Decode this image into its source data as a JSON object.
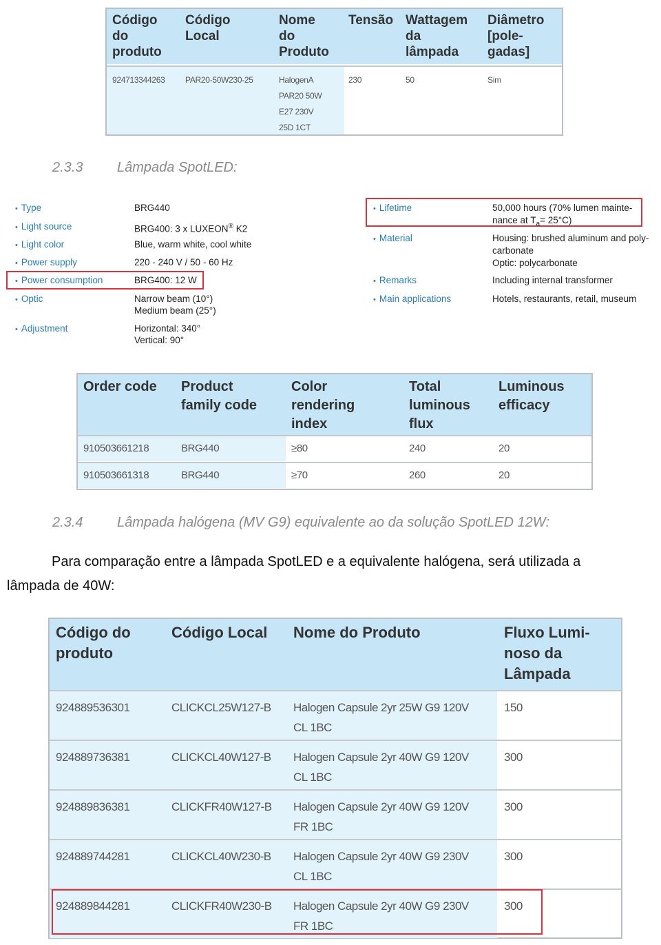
{
  "table_par20": {
    "headers": [
      "Código do produto",
      "Código Local",
      "Nome do Produto",
      "Tensão",
      "Wattagem da lâmpada",
      "Diâmetro [pole-gadas]"
    ],
    "header_lines": [
      [
        "Código",
        "do",
        "produto"
      ],
      [
        "Código",
        "Local"
      ],
      [
        "Nome",
        "do",
        "Produto"
      ],
      [
        "Tensão"
      ],
      [
        "Wattagem",
        "da",
        "lâmpada"
      ],
      [
        "Diâmetro",
        "[pole-",
        "gadas]"
      ]
    ],
    "rows": [
      {
        "codigo_produto": "924713344263",
        "codigo_local": "PAR20-50W230-25",
        "nome_lines": [
          "HalogenA",
          "PAR20 50W",
          "E27 230V",
          "25D 1CT"
        ],
        "tensao": "230",
        "wattagem": "50",
        "diametro": "Sim"
      }
    ]
  },
  "section_233": {
    "number": "2.3.3",
    "title": "Lâmpada SpotLED:"
  },
  "spec_left": [
    {
      "label": "Type",
      "value_lines": [
        "BRG440"
      ]
    },
    {
      "label": "Light source",
      "value_lines": [
        "BRG400: 3 x LUXEON® K2"
      ]
    },
    {
      "label": "Light color",
      "value_lines": [
        "Blue, warm white, cool white"
      ]
    },
    {
      "label": "Power supply",
      "value_lines": [
        "220 - 240 V / 50 - 60 Hz"
      ]
    },
    {
      "label": "Power consumption",
      "value_lines": [
        "BRG400: 12 W"
      ],
      "highlighted": true
    },
    {
      "label": "Optic",
      "value_lines": [
        "Narrow beam (10°)",
        "Medium beam (25°)"
      ]
    },
    {
      "label": "Adjustment",
      "value_lines": [
        "Horizontal: 340°",
        "Vertical: 90°"
      ]
    }
  ],
  "spec_right": [
    {
      "label": "Lifetime",
      "value_lines": [
        "50,000 hours (70% lumen mainte-",
        "nance at Ta= 25°C)"
      ],
      "highlighted": true
    },
    {
      "label": "Material",
      "value_lines": [
        "Housing: brushed aluminum and poly-",
        "carbonate",
        "Optic: polycarbonate"
      ]
    },
    {
      "label": "Remarks",
      "value_lines": [
        "Including internal transformer"
      ]
    },
    {
      "label": "Main applications",
      "value_lines": [
        "Hotels, restaurants, retail, museum"
      ]
    }
  ],
  "table_spotled": {
    "header_lines": [
      [
        "Order code"
      ],
      [
        "Product",
        "family code"
      ],
      [
        "Color",
        "rendering",
        "index"
      ],
      [
        "Total",
        "luminous",
        "flux"
      ],
      [
        "Luminous",
        "efficacy"
      ]
    ],
    "rows": [
      [
        "910503661218",
        "BRG440",
        "≥80",
        "240",
        "20"
      ],
      [
        "910503661318",
        "BRG440",
        "≥70",
        "260",
        "20"
      ]
    ]
  },
  "section_234": {
    "number": "2.3.4",
    "title": "Lâmpada halógena (MV G9) equivalente ao da solução SpotLED 12W:"
  },
  "paragraph": {
    "line1": "Para comparação entre a lâmpada SpotLED e a equivalente halógena, será utilizada a",
    "line2": "lâmpada de 40W:"
  },
  "table_halogen": {
    "header_lines": [
      [
        "Código do",
        "produto"
      ],
      [
        "Código Local"
      ],
      [
        "Nome do Produto"
      ],
      [
        "Fluxo Lumi-",
        "noso da",
        "Lâmpada"
      ]
    ],
    "rows": [
      {
        "codigo": "924889536301",
        "local": "CLICKCL25W127-B",
        "nome_lines": [
          "Halogen Capsule 2yr 25W G9 120V",
          "CL 1BC"
        ],
        "fluxo": "150"
      },
      {
        "codigo": "924889736381",
        "local": "CLICKCL40W127-B",
        "nome_lines": [
          "Halogen Capsule 2yr 40W G9 120V",
          "CL 1BC"
        ],
        "fluxo": "300"
      },
      {
        "codigo": "924889836381",
        "local": "CLICKFR40W127-B",
        "nome_lines": [
          "Halogen Capsule 2yr 40W G9 120V",
          "FR 1BC"
        ],
        "fluxo": "300"
      },
      {
        "codigo": "924889744281",
        "local": "CLICKCL40W230-B",
        "nome_lines": [
          "Halogen Capsule 2yr 40W G9 230V",
          "CL 1BC"
        ],
        "fluxo": "300"
      },
      {
        "codigo": "924889844281",
        "local": "CLICKFR40W230-B",
        "nome_lines": [
          "Halogen Capsule 2yr 40W G9 230V",
          "FR 1BC"
        ],
        "fluxo": "300",
        "highlighted": true
      }
    ]
  },
  "colors": {
    "table_header_bg": "#c6e6f7",
    "table_shade_bg": "#e3f3fc",
    "spec_label": "#2a7fb3",
    "highlight_border": "#d6333f",
    "heading_gray": "#8a8a8a"
  }
}
